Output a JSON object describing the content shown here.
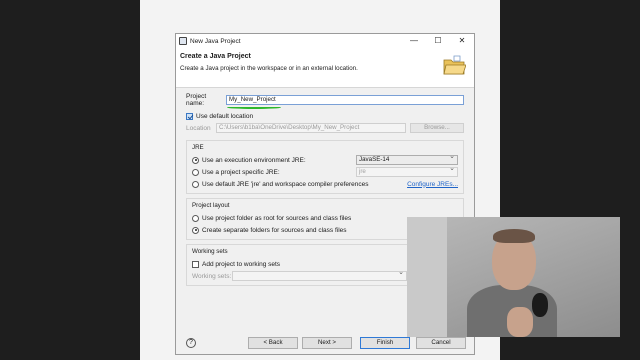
{
  "window": {
    "title": "New Java Project",
    "minimize": "—",
    "maximize": "☐",
    "close": "✕"
  },
  "header": {
    "title": "Create a Java Project",
    "description": "Create a Java project in the workspace or in an external location."
  },
  "project_name": {
    "label": "Project name:",
    "value": "My_New_Project"
  },
  "location": {
    "use_default_label": "Use default location",
    "use_default_checked": true,
    "label": "Location",
    "value": "C:\\Users\\b1ba\\OneDrive\\Desktop\\My_New_Project",
    "browse": "Browse..."
  },
  "jre": {
    "group_title": "JRE",
    "opt_env_label": "Use an execution environment JRE:",
    "opt_env_value": "JavaSE-14",
    "opt_specific_label": "Use a project specific JRE:",
    "opt_specific_value": "jre",
    "opt_default_label": "Use default JRE 'jre' and workspace compiler preferences",
    "configure_link": "Configure JREs..."
  },
  "layout": {
    "group_title": "Project layout",
    "opt_root": "Use project folder as root for sources and class files",
    "opt_separate": "Create separate folders for sources and class files"
  },
  "working_sets": {
    "group_title": "Working sets",
    "add_label": "Add project to working sets",
    "sets_label": "Working sets:"
  },
  "footer": {
    "help": "?",
    "back": "< Back",
    "next": "Next >",
    "finish": "Finish",
    "cancel": "Cancel"
  }
}
